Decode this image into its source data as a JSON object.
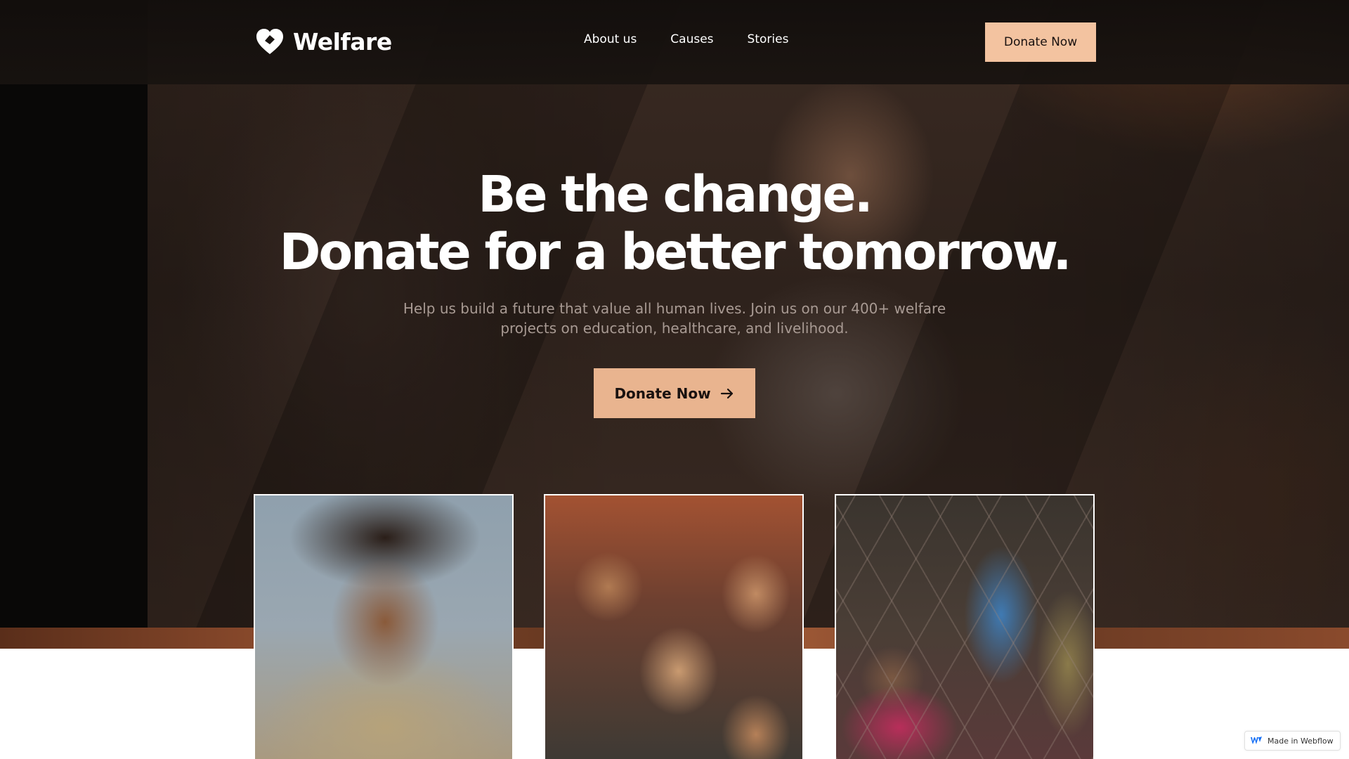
{
  "brand": {
    "name": "Welfare",
    "logo_icon": "heart-icon"
  },
  "nav": {
    "links": [
      "About us",
      "Causes",
      "Stories"
    ],
    "cta_label": "Donate Now"
  },
  "hero": {
    "title_line1": "Be the change.",
    "title_line2": "Donate for a better tomorrow.",
    "subtitle": "Help us build a future that value all human lives. Join us on our 400+ welfare projects on education, healthcare, and livelihood.",
    "cta_label": "Donate Now",
    "cta_icon": "arrow-right-icon"
  },
  "badge": {
    "label": "Made in Webflow"
  },
  "colors": {
    "accent": "#f3c3a0",
    "hero_cta": "#e9b48f",
    "hero_bg": "#2e221c",
    "text_light": "#ffffff",
    "subtitle": "#a89a93"
  }
}
